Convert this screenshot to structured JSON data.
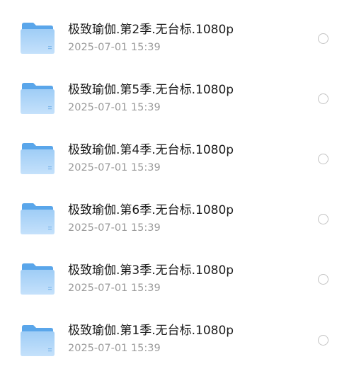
{
  "files": [
    {
      "name": "极致瑜伽.第2季.无台标.1080p",
      "date": "2025-07-01 15:39"
    },
    {
      "name": "极致瑜伽.第5季.无台标.1080p",
      "date": "2025-07-01 15:39"
    },
    {
      "name": "极致瑜伽.第4季.无台标.1080p",
      "date": "2025-07-01 15:39"
    },
    {
      "name": "极致瑜伽.第6季.无台标.1080p",
      "date": "2025-07-01 15:39"
    },
    {
      "name": "极致瑜伽.第3季.无台标.1080p",
      "date": "2025-07-01 15:39"
    },
    {
      "name": "极致瑜伽.第1季.无台标.1080p",
      "date": "2025-07-01 15:39"
    }
  ],
  "colors": {
    "folder_back": "#5aa6ea",
    "folder_front_top": "#9fcdf6",
    "folder_front_bottom": "#c5e1fb",
    "name_text": "#1b1b1b",
    "date_text": "#9a9a9a",
    "radio_border": "#c4c4c4"
  },
  "icons": {
    "folder": "folder-icon",
    "select": "radio-unchecked"
  }
}
